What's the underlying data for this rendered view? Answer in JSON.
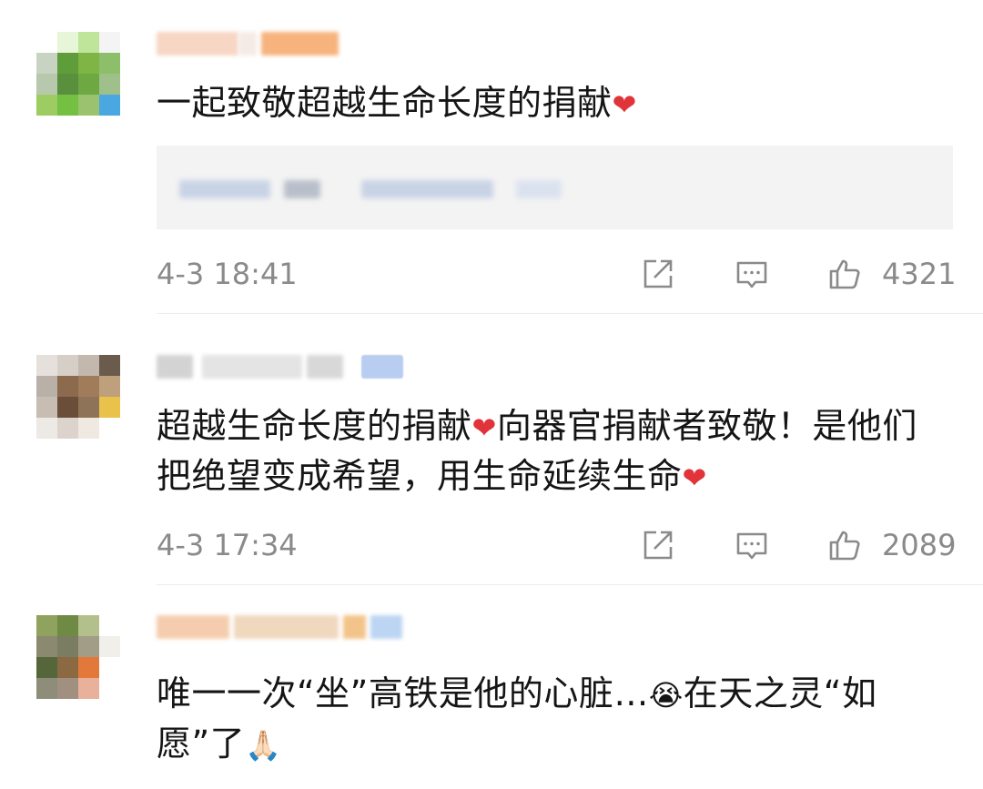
{
  "comments": [
    {
      "text": "一起致敬超越生命长度的捐献",
      "text_suffix": "❤",
      "time": "4-3 18:41",
      "likes": "4321"
    },
    {
      "text": "超越生命长度的捐献",
      "text_mid": "❤",
      "text_after": "向器官捐献者致敬！是他们把绝望变成希望，用生命延续生命",
      "text_end": "❤",
      "time": "4-3 17:34",
      "likes": "2089"
    },
    {
      "text": "唯一一次“坐”高铁是他的心脏…",
      "emoji1": "😭",
      "text_after": "在天之灵“如愿”了",
      "emoji2": "🙏🏻"
    }
  ],
  "icons": {
    "share": "share-icon",
    "comment": "comment-icon",
    "like": "thumbs-up-icon"
  },
  "colors": {
    "text": "#151515",
    "meta": "#8a8a8a",
    "heart": "#e0333a",
    "quote_bg": "#f3f3f3"
  }
}
